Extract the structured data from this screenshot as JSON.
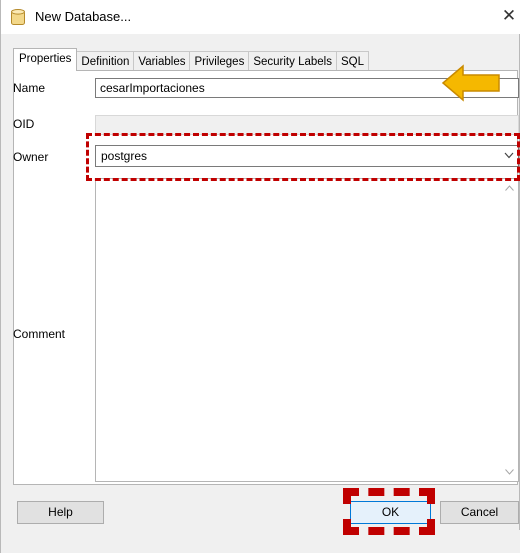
{
  "window": {
    "title": "New Database...",
    "close_glyph": "✕"
  },
  "tabs": [
    {
      "label": "Properties",
      "active": true
    },
    {
      "label": "Definition",
      "active": false
    },
    {
      "label": "Variables",
      "active": false
    },
    {
      "label": "Privileges",
      "active": false
    },
    {
      "label": "Security Labels",
      "active": false
    },
    {
      "label": "SQL",
      "active": false
    }
  ],
  "form": {
    "name_label": "Name",
    "name_value": "cesarImportaciones",
    "oid_label": "OID",
    "oid_value": "",
    "owner_label": "Owner",
    "owner_value": "postgres",
    "comment_label": "Comment",
    "comment_value": ""
  },
  "buttons": {
    "help": "Help",
    "ok": "OK",
    "cancel": "Cancel"
  },
  "annotations": {
    "arrow_color": "#f5b800",
    "highlight_color": "#c00000"
  },
  "icons": {
    "title": "database-icon",
    "owner_dropdown": "chevron-down-icon"
  }
}
